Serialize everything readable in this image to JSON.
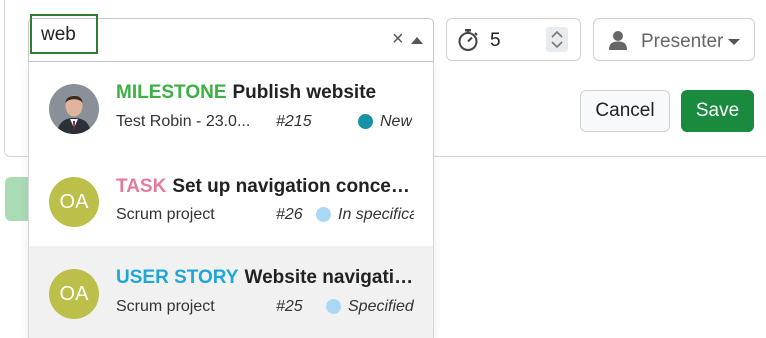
{
  "search": {
    "value": "web",
    "clear_glyph": "×"
  },
  "timer": {
    "value": "5",
    "icon": "stopwatch-icon"
  },
  "presenter": {
    "label": "Presenter",
    "icon": "person-icon"
  },
  "actions": {
    "cancel_label": "Cancel",
    "save_label": "Save"
  },
  "colors": {
    "milestone": "#3cb043",
    "task": "#e57aa1",
    "user_story": "#1ea7d6",
    "save": "#198a3e",
    "status_new": "#1591a8",
    "status_light": "#a9d8f5"
  },
  "results": [
    {
      "type": "MILESTONE",
      "title": "Publish website",
      "meta": "Test Robin - 23.0...",
      "number": "#215",
      "status": "New",
      "avatar": "user-photo"
    },
    {
      "type": "TASK",
      "title": "Set up navigation concept ...",
      "meta": "Scrum project",
      "number": "#26",
      "status": "In specifica",
      "avatar_initials": "OA"
    },
    {
      "type": "USER STORY",
      "title": "Website navigation...",
      "meta": "Scrum project",
      "number": "#25",
      "status": "Specified",
      "avatar_initials": "OA"
    }
  ]
}
